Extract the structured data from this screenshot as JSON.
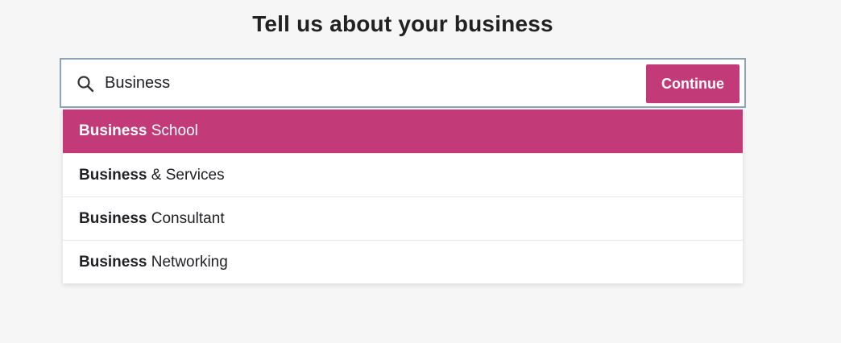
{
  "page": {
    "title": "Tell us about your business"
  },
  "search": {
    "value": "Business",
    "placeholder": ""
  },
  "buttons": {
    "continue_label": "Continue"
  },
  "suggestions": [
    {
      "match": "Business",
      "rest": " School"
    },
    {
      "match": "Business",
      "rest": " & Services"
    },
    {
      "match": "Business",
      "rest": " Consultant"
    },
    {
      "match": "Business",
      "rest": " Networking"
    }
  ],
  "icons": {
    "search": "search-icon"
  },
  "colors": {
    "accent": "#c23b78",
    "input_border": "#8ea2b8",
    "background": "#f6f6f6"
  }
}
